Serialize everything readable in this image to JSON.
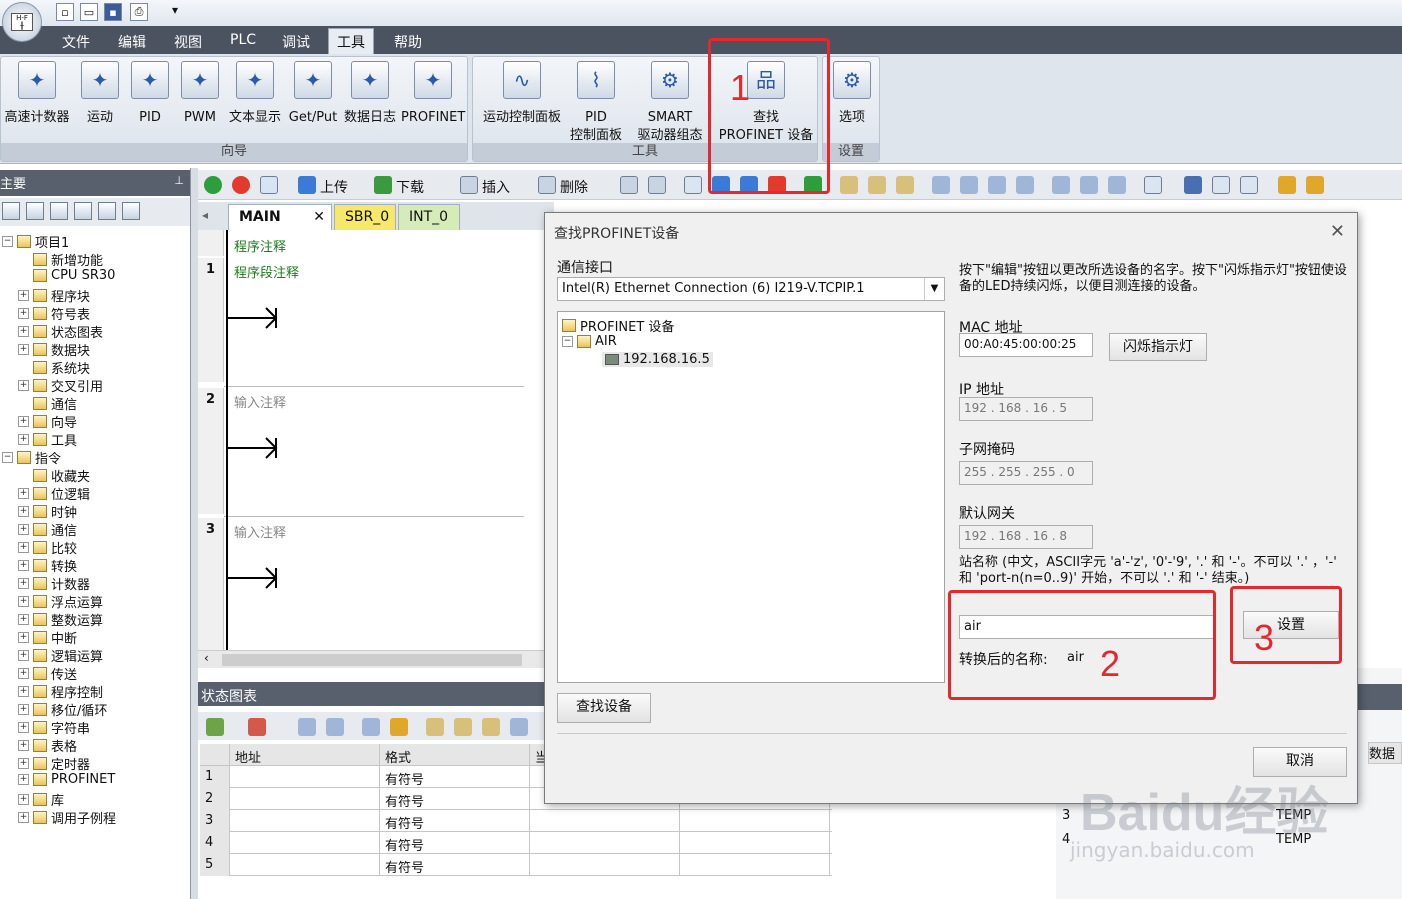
{
  "menu": [
    "文件",
    "编辑",
    "视图",
    "PLC",
    "调试",
    "工具",
    "帮助"
  ],
  "ribbon": {
    "wizard_group": {
      "caption": "向导",
      "items": [
        "高速计数器",
        "运动",
        "PID",
        "PWM",
        "文本显示",
        "Get/Put",
        "数据日志",
        "PROFINET"
      ]
    },
    "tools_group": {
      "caption": "工具",
      "items": [
        [
          "运动控制面板"
        ],
        [
          "PID",
          "控制面板"
        ],
        [
          "SMART",
          "驱动器组态"
        ],
        [
          "查找",
          "PROFINET 设备"
        ]
      ]
    },
    "settings_group": {
      "caption": "设置",
      "items": [
        "选项"
      ]
    }
  },
  "left_panel": {
    "title": "主要"
  },
  "tree": [
    {
      "label": "项目1",
      "level": 0,
      "exp": "-"
    },
    {
      "label": "新增功能",
      "level": 1,
      "exp": ""
    },
    {
      "label": "CPU SR30",
      "level": 1,
      "exp": ""
    },
    {
      "label": "程序块",
      "level": 1,
      "exp": "+"
    },
    {
      "label": "符号表",
      "level": 1,
      "exp": "+"
    },
    {
      "label": "状态图表",
      "level": 1,
      "exp": "+"
    },
    {
      "label": "数据块",
      "level": 1,
      "exp": "+"
    },
    {
      "label": "系统块",
      "level": 1,
      "exp": ""
    },
    {
      "label": "交叉引用",
      "level": 1,
      "exp": "+"
    },
    {
      "label": "通信",
      "level": 1,
      "exp": ""
    },
    {
      "label": "向导",
      "level": 1,
      "exp": "+"
    },
    {
      "label": "工具",
      "level": 1,
      "exp": "+"
    },
    {
      "label": "指令",
      "level": 0,
      "exp": "-"
    },
    {
      "label": "收藏夹",
      "level": 1,
      "exp": ""
    },
    {
      "label": "位逻辑",
      "level": 1,
      "exp": "+"
    },
    {
      "label": "时钟",
      "level": 1,
      "exp": "+"
    },
    {
      "label": "通信",
      "level": 1,
      "exp": "+"
    },
    {
      "label": "比较",
      "level": 1,
      "exp": "+"
    },
    {
      "label": "转换",
      "level": 1,
      "exp": "+"
    },
    {
      "label": "计数器",
      "level": 1,
      "exp": "+"
    },
    {
      "label": "浮点运算",
      "level": 1,
      "exp": "+"
    },
    {
      "label": "整数运算",
      "level": 1,
      "exp": "+"
    },
    {
      "label": "中断",
      "level": 1,
      "exp": "+"
    },
    {
      "label": "逻辑运算",
      "level": 1,
      "exp": "+"
    },
    {
      "label": "传送",
      "level": 1,
      "exp": "+"
    },
    {
      "label": "程序控制",
      "level": 1,
      "exp": "+"
    },
    {
      "label": "移位/循环",
      "level": 1,
      "exp": "+"
    },
    {
      "label": "字符串",
      "level": 1,
      "exp": "+"
    },
    {
      "label": "表格",
      "level": 1,
      "exp": "+"
    },
    {
      "label": "定时器",
      "level": 1,
      "exp": "+"
    },
    {
      "label": "PROFINET",
      "level": 1,
      "exp": "+"
    },
    {
      "label": "库",
      "level": 1,
      "exp": "+"
    },
    {
      "label": "调用子例程",
      "level": 1,
      "exp": "+"
    }
  ],
  "main_toolbar": {
    "upload": "上传",
    "download": "下载",
    "insert": "插入",
    "delete": "删除"
  },
  "tabs": [
    "MAIN",
    "SBR_0",
    "INT_0"
  ],
  "editor": {
    "program_comment": "程序注释",
    "networks": [
      {
        "num": "1",
        "comment": "程序段注释"
      },
      {
        "num": "2",
        "comment": "输入注释"
      },
      {
        "num": "3",
        "comment": "输入注释"
      }
    ]
  },
  "status_chart": {
    "title": "状态图表",
    "headers": [
      "",
      "地址",
      "格式",
      "当"
    ],
    "rows": [
      [
        "1",
        "",
        "有符号"
      ],
      [
        "2",
        "",
        "有符号"
      ],
      [
        "3",
        "",
        "有符号"
      ],
      [
        "4",
        "",
        "有符号"
      ],
      [
        "5",
        "",
        "有符号"
      ]
    ]
  },
  "right_partial": {
    "header": "数据类",
    "rows": [
      [
        "3",
        "TEMP"
      ],
      [
        "4",
        "TEMP"
      ]
    ]
  },
  "dialog": {
    "title": "查找PROFINET设备",
    "iface_label": "通信接口",
    "iface_value": "Intel(R) Ethernet Connection (6) I219-V.TCPIP.1",
    "tree_root": "PROFINET 设备",
    "tree_dev": "AIR",
    "tree_ip": "192.168.16.5",
    "instruction": "按下\"编辑\"按钮以更改所选设备的名字。按下\"闪烁指示灯\"按钮使设备的LED持续闪烁，以便目测连接的设备。",
    "mac_label": "MAC 地址",
    "mac_value": "00:A0:45:00:00:25",
    "blink_btn": "闪烁指示灯",
    "ip_label": "IP 地址",
    "ip_value": "192 . 168 . 16  .  5",
    "mask_label": "子网掩码",
    "mask_value": "255 . 255 . 255 .  0",
    "gw_label": "默认网关",
    "gw_value": "192 . 168 . 16  .  8",
    "station_hint": "站名称 (中文，ASCII字元 'a'-'z', '0'-'9', '.' 和 '-'。不可以 '.' ，'-' 和 'port-n(n=0..9)' 开始，不可以 '.' 和 '-' 结束。)",
    "station_value": "air",
    "set_btn": "设置",
    "converted_label": "转换后的名称:",
    "converted_value": "air",
    "find_btn": "查找设备",
    "cancel_btn": "取消"
  },
  "annotations": [
    "1",
    "2",
    "3"
  ],
  "watermark": {
    "text": "Baidu经验",
    "sub": "jingyan.baidu.com"
  },
  "colors": {
    "menubar": "#4b5260",
    "annotation_red": "#e5282e",
    "comment_green": "#1a7f1a"
  }
}
